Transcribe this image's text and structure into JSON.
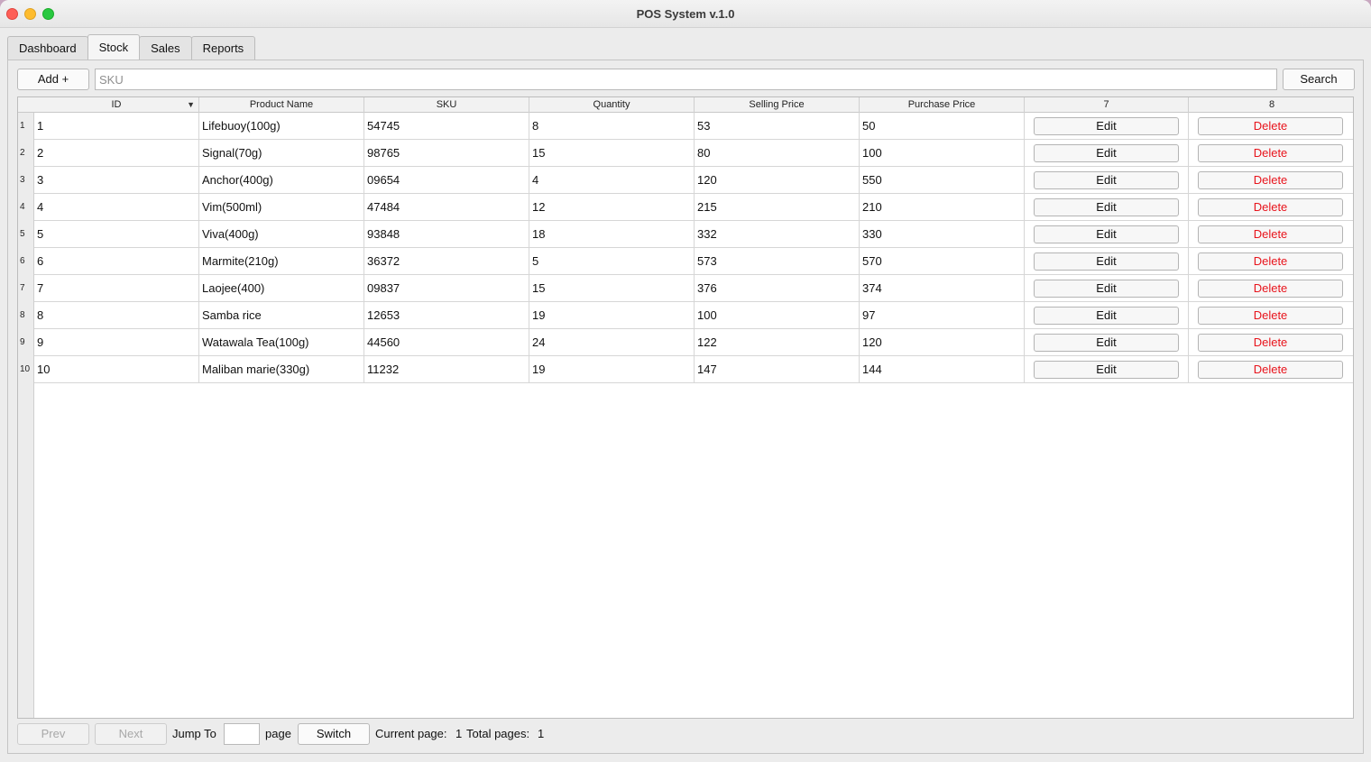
{
  "window": {
    "title": "POS System v.1.0"
  },
  "tabs": [
    {
      "label": "Dashboard"
    },
    {
      "label": "Stock"
    },
    {
      "label": "Sales"
    },
    {
      "label": "Reports"
    }
  ],
  "toolbar": {
    "add_label": "Add +",
    "sku_placeholder": "SKU",
    "sku_value": "",
    "search_label": "Search"
  },
  "table": {
    "headers": [
      "ID",
      "Product Name",
      "SKU",
      "Quantity",
      "Selling Price",
      "Purchase Price",
      "7",
      "8"
    ],
    "edit_label": "Edit",
    "delete_label": "Delete",
    "rows": [
      {
        "n": "1",
        "id": "1",
        "name": "Lifebuoy(100g)",
        "sku": "54745",
        "qty": "8",
        "sell": "53",
        "purchase": "50"
      },
      {
        "n": "2",
        "id": "2",
        "name": "Signal(70g)",
        "sku": "98765",
        "qty": "15",
        "sell": "80",
        "purchase": "100"
      },
      {
        "n": "3",
        "id": "3",
        "name": "Anchor(400g)",
        "sku": "09654",
        "qty": "4",
        "sell": "120",
        "purchase": "550"
      },
      {
        "n": "4",
        "id": "4",
        "name": "Vim(500ml)",
        "sku": "47484",
        "qty": "12",
        "sell": "215",
        "purchase": "210"
      },
      {
        "n": "5",
        "id": "5",
        "name": "Viva(400g)",
        "sku": "93848",
        "qty": "18",
        "sell": "332",
        "purchase": "330"
      },
      {
        "n": "6",
        "id": "6",
        "name": "Marmite(210g)",
        "sku": "36372",
        "qty": "5",
        "sell": "573",
        "purchase": "570"
      },
      {
        "n": "7",
        "id": "7",
        "name": "Laojee(400)",
        "sku": "09837",
        "qty": "15",
        "sell": "376",
        "purchase": "374"
      },
      {
        "n": "8",
        "id": "8",
        "name": "Samba rice",
        "sku": "12653",
        "qty": "19",
        "sell": "100",
        "purchase": "97"
      },
      {
        "n": "9",
        "id": "9",
        "name": "Watawala Tea(100g)",
        "sku": "44560",
        "qty": "24",
        "sell": "122",
        "purchase": "120"
      },
      {
        "n": "10",
        "id": "10",
        "name": "Maliban marie(330g)",
        "sku": "11232",
        "qty": "19",
        "sell": "147",
        "purchase": "144"
      }
    ]
  },
  "pager": {
    "prev_label": "Prev",
    "next_label": "Next",
    "jump_label": "Jump To",
    "jump_value": "",
    "page_label": "page",
    "switch_label": "Switch",
    "current_label": "Current page:",
    "current_value": "1",
    "total_label": "Total pages:",
    "total_value": "1"
  },
  "colors": {
    "delete_text": "#e8141c",
    "window_bg": "#ececec"
  },
  "icons": {
    "sort": "sort-down-icon"
  }
}
